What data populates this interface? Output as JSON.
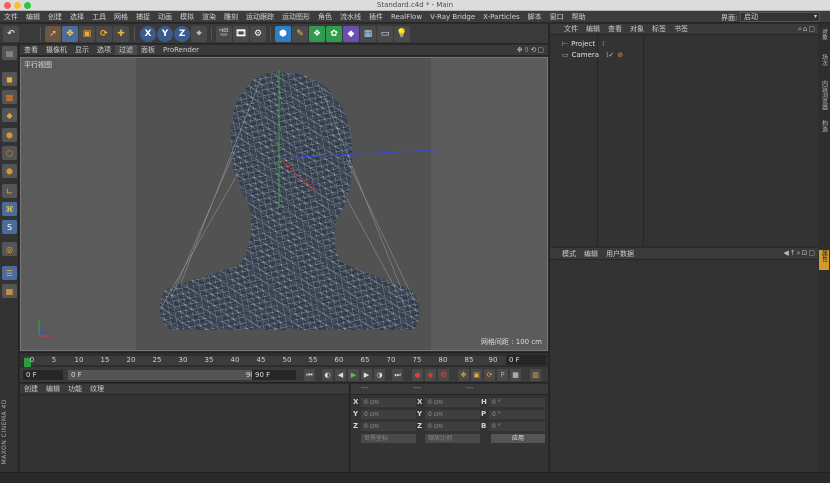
{
  "window": {
    "title": "Standard.c4d * - Main"
  },
  "menubar": {
    "items": [
      "文件",
      "编辑",
      "创建",
      "选择",
      "工具",
      "网格",
      "捕捉",
      "动画",
      "模拟",
      "渲染",
      "雕刻",
      "运动跟踪",
      "运动图形",
      "角色",
      "流水线",
      "插件",
      "RealFlow",
      "V-Ray Bridge",
      "X-Particles",
      "脚本",
      "窗口",
      "帮助"
    ],
    "layout_label": "界面:",
    "layout_value": "启动"
  },
  "toolbar": {
    "axis_x": "X",
    "axis_y": "Y",
    "axis_z": "Z"
  },
  "viewport": {
    "menu": [
      "查看",
      "摄像机",
      "显示",
      "选项",
      "过滤",
      "面板",
      "ProRender"
    ],
    "active_menu": "过滤",
    "view_name": "平行视图",
    "grid_spacing": "网格间距 : 100 cm"
  },
  "timeline": {
    "ticks": [
      "0",
      "5",
      "10",
      "15",
      "20",
      "25",
      "30",
      "35",
      "40",
      "45",
      "50",
      "55",
      "60",
      "65",
      "70",
      "75",
      "80",
      "85",
      "90"
    ],
    "current_frame": "0 F"
  },
  "transport": {
    "start_frame": "0 F",
    "range_start": "0 F",
    "range_end": "90 F",
    "end_frame": "90 F"
  },
  "material_panel": {
    "menu": [
      "创建",
      "编辑",
      "功能",
      "纹理"
    ]
  },
  "coord_panel": {
    "header": [
      "---",
      "---",
      "---"
    ],
    "rows": [
      {
        "a1": "X",
        "v1": "0 cm",
        "a2": "X",
        "v2": "0 cm",
        "a3": "H",
        "v3": "0 °"
      },
      {
        "a1": "Y",
        "v1": "0 cm",
        "a2": "Y",
        "v2": "0 cm",
        "a3": "P",
        "v3": "0 °"
      },
      {
        "a1": "Z",
        "v1": "0 cm",
        "a2": "Z",
        "v2": "0 cm",
        "a3": "B",
        "v3": "0 °"
      }
    ],
    "dropdown_1": "世界坐标",
    "dropdown_2": "缩放比例",
    "apply_label": "应用"
  },
  "object_panel": {
    "menu": [
      "文件",
      "编辑",
      "查看",
      "对象",
      "标签",
      "书签"
    ],
    "objects": [
      {
        "name": "Project"
      },
      {
        "name": "Camera"
      }
    ]
  },
  "attribute_panel": {
    "menu": [
      "模式",
      "编辑",
      "用户数据"
    ]
  },
  "side_tabs": [
    "对象",
    "场次",
    "内容浏览器",
    "构造",
    "属性"
  ],
  "brand": "MAXON CINEMA 4D",
  "colors": {
    "accent_orange": "#d39a2e",
    "playhead_green": "#2d9c3d",
    "viewport_bg": "#5b5b5b"
  }
}
